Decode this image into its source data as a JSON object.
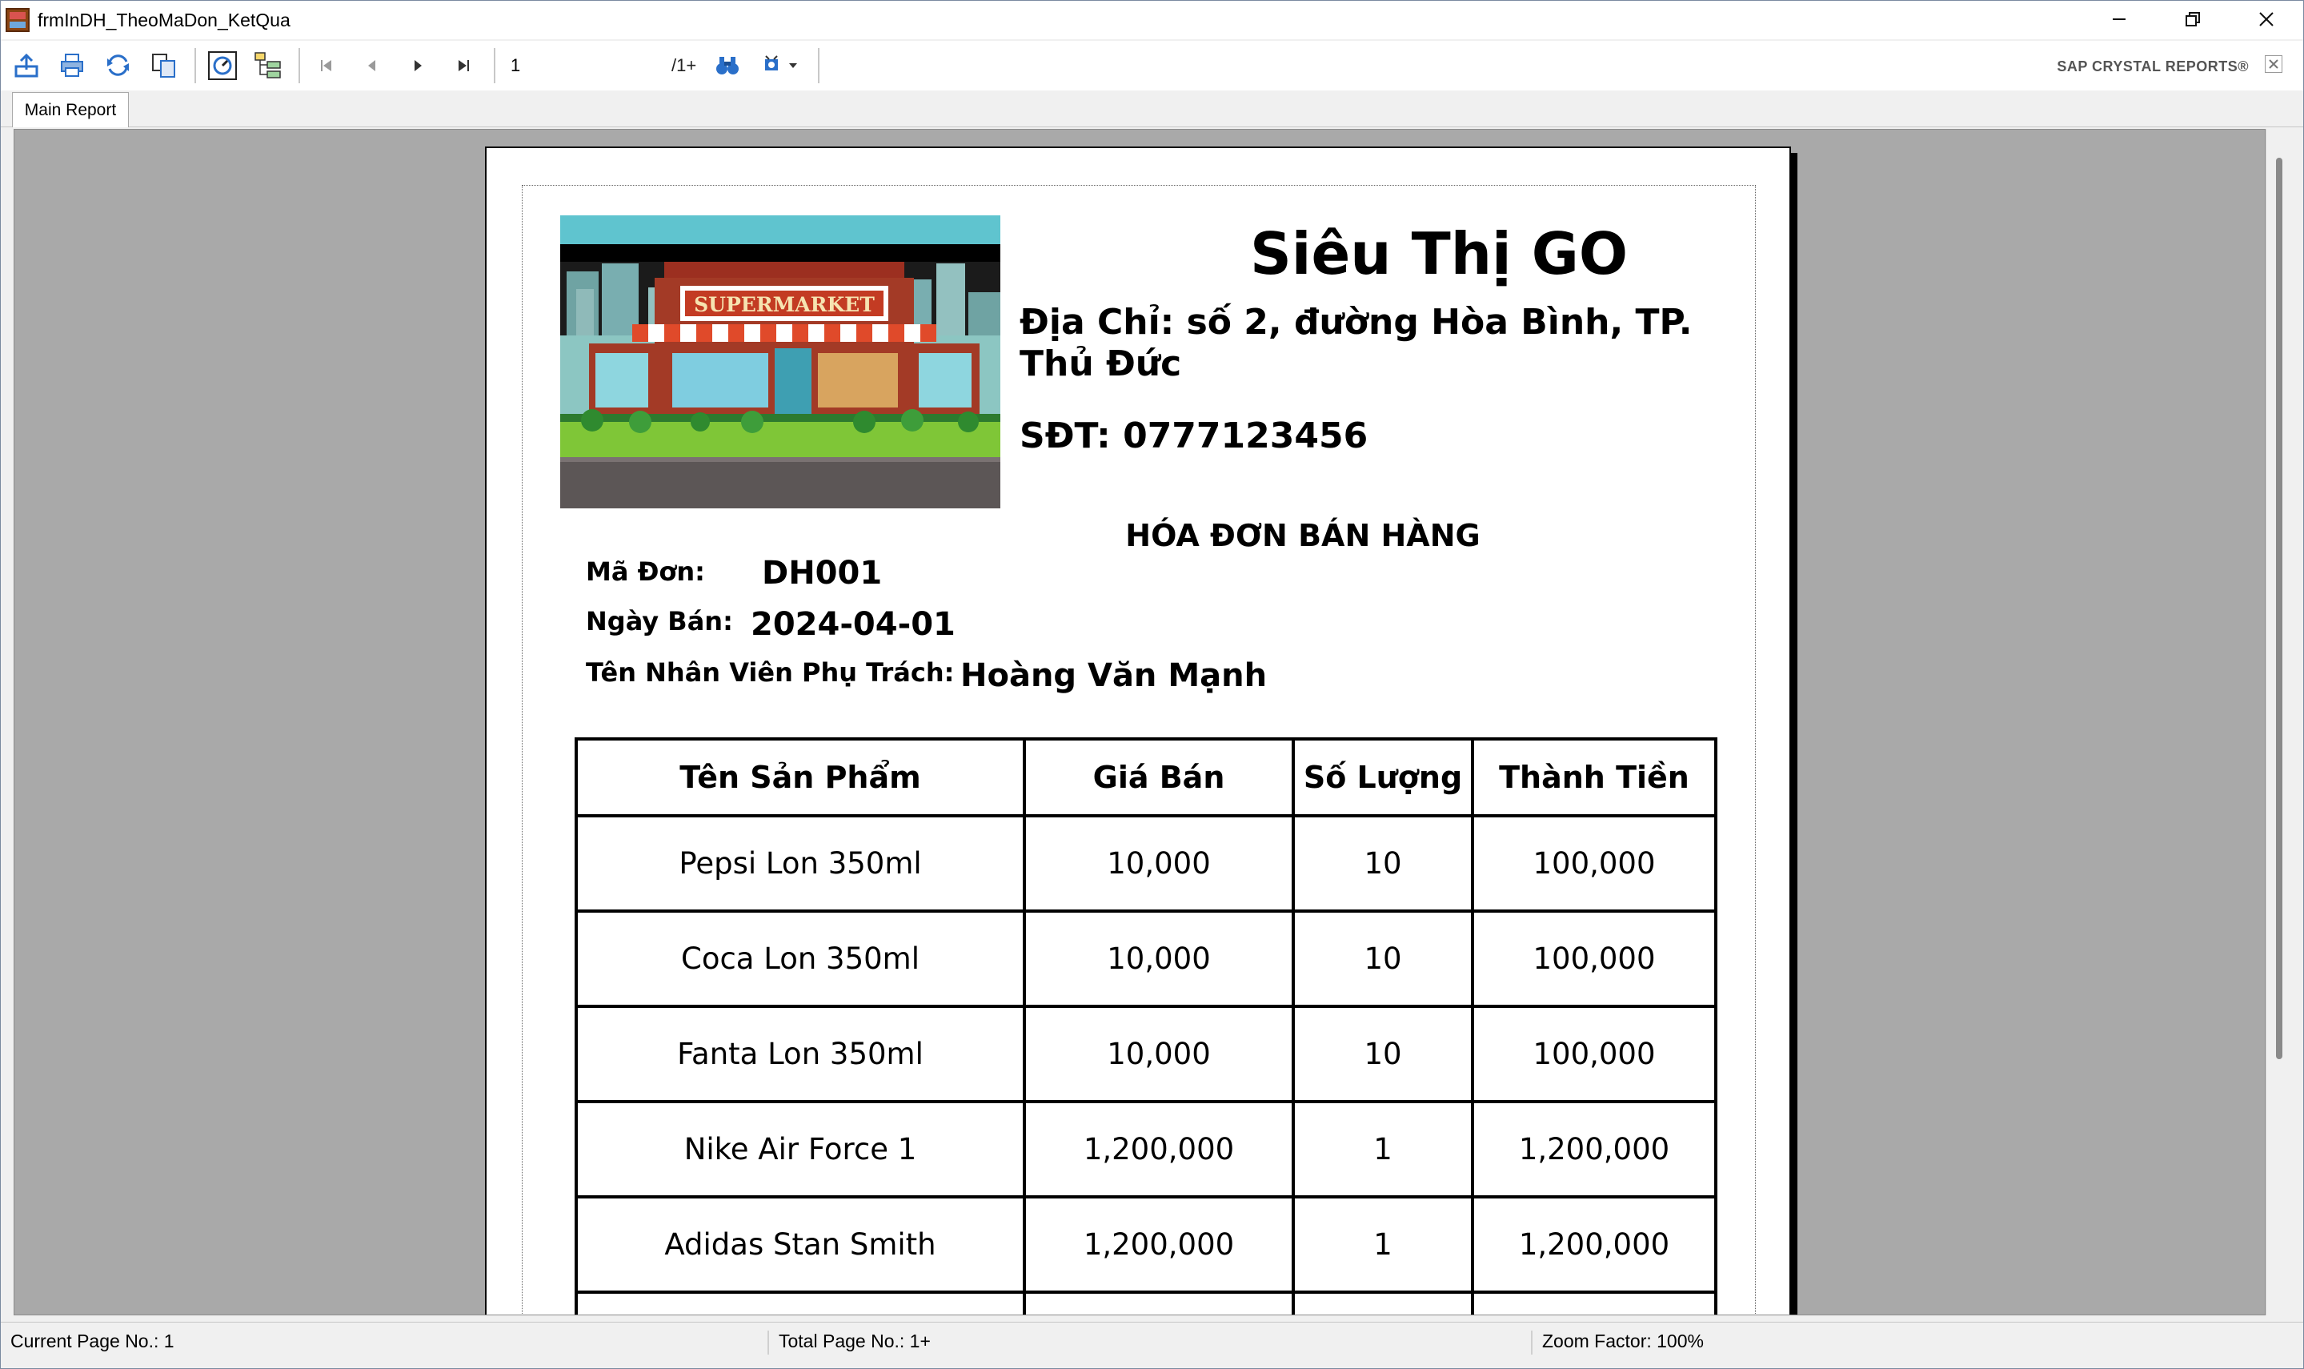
{
  "window": {
    "title": "frmInDH_TheoMaDon_KetQua"
  },
  "toolbar": {
    "page_number_value": "1",
    "page_total": "/1+",
    "brand": "SAP CRYSTAL REPORTS®"
  },
  "tabs": [
    {
      "label": "Main Report"
    }
  ],
  "report": {
    "shop_name": "Siêu Thị GO",
    "address": "Địa Chỉ: số 2, đường Hòa Bình, TP. Thủ Đức",
    "phone": "SĐT: 0777123456",
    "invoice_title": "HÓA ĐƠN BÁN HÀNG",
    "logo_sign_text": "SUPERMARKET",
    "order_id_label": "Mã Đơn:",
    "order_id": "DH001",
    "sale_date_label": "Ngày Bán:",
    "sale_date": "2024-04-01",
    "staff_label": "Tên Nhân Viên Phụ Trách:",
    "staff_name": "Hoàng Văn Mạnh",
    "table": {
      "headers": [
        "Tên Sản Phẩm",
        "Giá Bán",
        "Số Lượng",
        "Thành Tiền"
      ],
      "rows": [
        [
          "Pepsi Lon 350ml",
          "10,000",
          "10",
          "100,000"
        ],
        [
          "Coca Lon 350ml",
          "10,000",
          "10",
          "100,000"
        ],
        [
          "Fanta Lon 350ml",
          "10,000",
          "10",
          "100,000"
        ],
        [
          "Nike Air Force 1",
          "1,200,000",
          "1",
          "1,200,000"
        ],
        [
          "Adidas Stan Smith",
          "1,200,000",
          "1",
          "1,200,000"
        ],
        [
          "",
          "",
          "",
          ""
        ]
      ]
    }
  },
  "status": {
    "current_page": "Current Page No.: 1",
    "total_page": "Total Page No.: 1+",
    "zoom": "Zoom Factor: 100%"
  }
}
